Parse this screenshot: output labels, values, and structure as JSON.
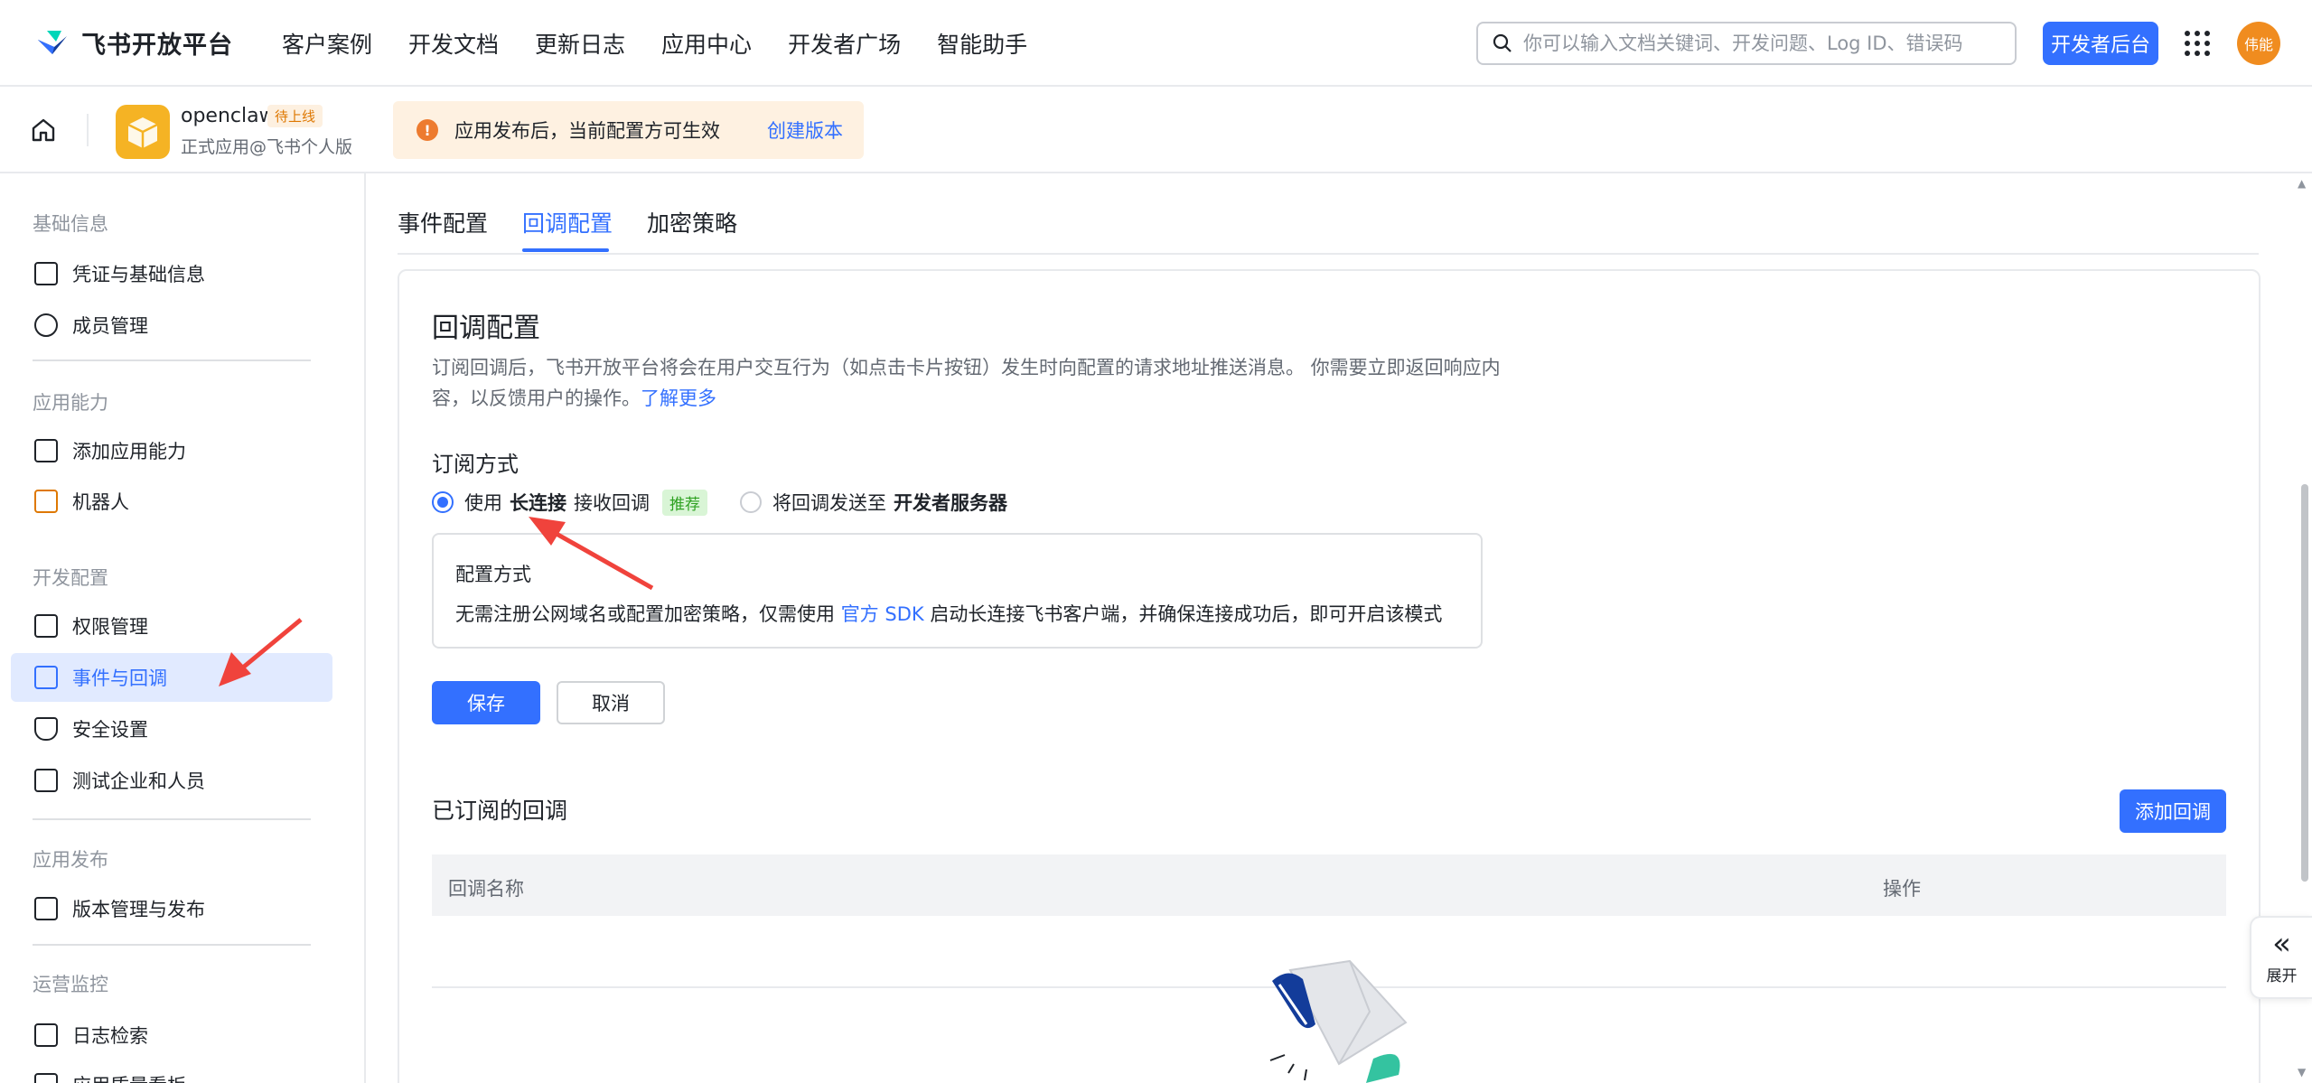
{
  "topnav": {
    "logo_text": "飞书开放平台",
    "links": [
      "客户案例",
      "开发文档",
      "更新日志",
      "应用中心",
      "开发者广场",
      "智能助手"
    ],
    "search_placeholder": "你可以输入文档关键词、开发问题、Log ID、错误码",
    "dev_console_label": "开发者后台",
    "avatar_text": "伟能"
  },
  "appbar": {
    "app_name": "openclaw",
    "app_status": "待上线",
    "app_sub": "正式应用@飞书个人版",
    "notice_text": "应用发布后，当前配置方可生效",
    "notice_link": "创建版本"
  },
  "sidebar": {
    "groups": [
      "基础信息",
      "应用能力",
      "开发配置",
      "应用发布",
      "运营监控"
    ],
    "items": [
      {
        "label": "凭证与基础信息",
        "icon": "credential-icon"
      },
      {
        "label": "成员管理",
        "icon": "member-icon"
      },
      {
        "label": "添加应用能力",
        "icon": "app-ability-icon"
      },
      {
        "label": "机器人",
        "icon": "robot-icon"
      },
      {
        "label": "权限管理",
        "icon": "permission-icon"
      },
      {
        "label": "事件与回调",
        "icon": "event-callback-icon",
        "active": true
      },
      {
        "label": "安全设置",
        "icon": "security-icon"
      },
      {
        "label": "测试企业和人员",
        "icon": "test-icon"
      },
      {
        "label": "版本管理与发布",
        "icon": "version-icon"
      },
      {
        "label": "日志检索",
        "icon": "log-search-icon"
      },
      {
        "label": "应用质量看板",
        "icon": "quality-icon"
      }
    ]
  },
  "tabs": [
    {
      "label": "事件配置",
      "active": false
    },
    {
      "label": "回调配置",
      "active": true
    },
    {
      "label": "加密策略",
      "active": false
    }
  ],
  "callback": {
    "title": "回调配置",
    "desc": "订阅回调后，飞书开放平台将会在用户交互行为（如点击卡片按钮）发生时向配置的请求地址推送消息。 你需要立即返回响应内容，以反馈用户的操作。",
    "learn_more": "了解更多",
    "subscribe_label": "订阅方式",
    "option1_prefix": "使用",
    "option1_bold": "长连接",
    "option1_suffix": "接收回调",
    "option1_tag": "推荐",
    "option2_prefix": "将回调发送至",
    "option2_bold": "开发者服务器",
    "config_title": "配置方式",
    "config_text_1": "无需注册公网域名或配置加密策略，仅需使用",
    "config_link": "官方 SDK",
    "config_text_2": "启动长连接飞书客户端，并确保连接成功后，即可开启该模式",
    "save_label": "保存",
    "cancel_label": "取消",
    "subscribed_title": "已订阅的回调",
    "add_label": "添加回调",
    "col_name": "回调名称",
    "col_action": "操作"
  },
  "expand_label": "展开",
  "colors": {
    "primary": "#3370ff",
    "arrow": "#f0433c"
  }
}
